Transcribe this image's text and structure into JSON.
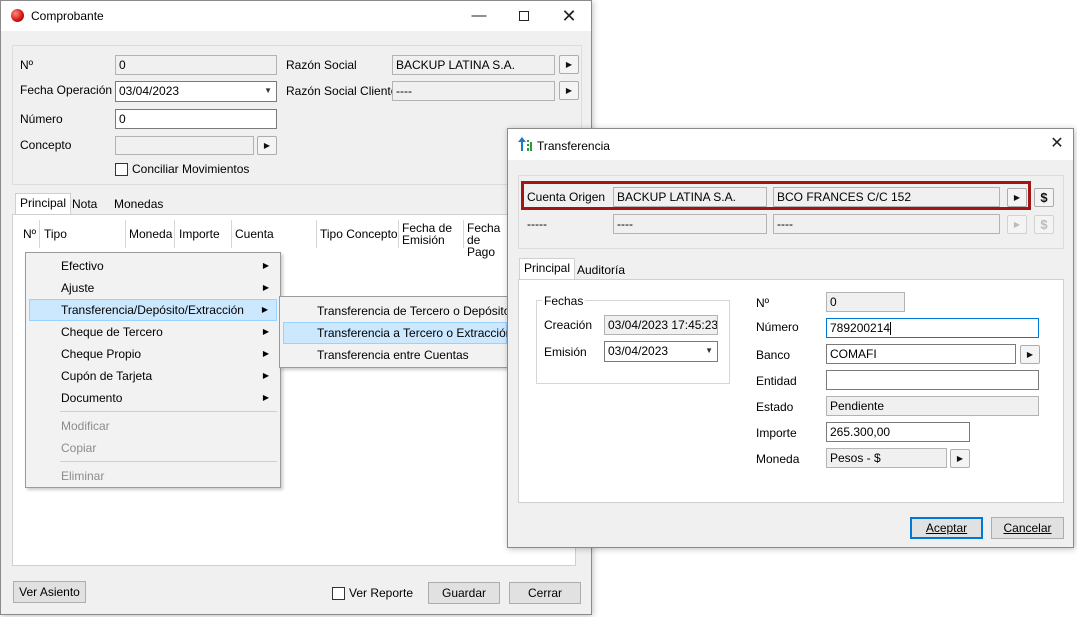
{
  "comprobante": {
    "title": "Comprobante",
    "fields": {
      "numero_label": "Nº",
      "numero_value": "0",
      "fecha_label": "Fecha Operación",
      "fecha_value": "03/04/2023",
      "numero2_label": "Número",
      "numero2_value": "0",
      "concepto_label": "Concepto",
      "concepto_value": "",
      "conciliar_label": "Conciliar Movimientos",
      "razon_label": "Razón Social",
      "razon_value": "BACKUP LATINA S.A.",
      "razon_cliente_label": "Razón Social Cliente",
      "razon_cliente_value": "----"
    },
    "tabs": [
      "Principal",
      "Nota",
      "Monedas"
    ],
    "columns": [
      "Nº",
      "Tipo",
      "Moneda",
      "Importe",
      "Cuenta",
      "Tipo Concepto",
      "Fecha de Emisión",
      "Fecha de Pago"
    ],
    "buttons": {
      "ver_asiento": "Ver Asiento",
      "ver_reporte": "Ver Reporte",
      "guardar": "Guardar",
      "cerrar": "Cerrar"
    }
  },
  "context_menu": {
    "items": [
      {
        "label": "Efectivo",
        "submenu": true,
        "disabled": false
      },
      {
        "label": "Ajuste",
        "submenu": true,
        "disabled": false
      },
      {
        "label": "Transferencia/Depósito/Extracción",
        "submenu": true,
        "disabled": false,
        "highlighted": true
      },
      {
        "label": "Cheque de Tercero",
        "submenu": true,
        "disabled": false
      },
      {
        "label": "Cheque Propio",
        "submenu": true,
        "disabled": false
      },
      {
        "label": "Cupón de Tarjeta",
        "submenu": true,
        "disabled": false
      },
      {
        "label": "Documento",
        "submenu": true,
        "disabled": false
      },
      {
        "label": "Modificar",
        "submenu": false,
        "disabled": true
      },
      {
        "label": "Copiar",
        "submenu": false,
        "disabled": true
      },
      {
        "label": "Eliminar",
        "submenu": false,
        "disabled": true
      }
    ],
    "submenu": [
      {
        "label": "Transferencia de Tercero o Depósito"
      },
      {
        "label": "Transferencia a Tercero o Extracción",
        "highlighted": true
      },
      {
        "label": "Transferencia entre Cuentas"
      }
    ]
  },
  "transferencia": {
    "title": "Transferencia",
    "cuenta_origen_label": "Cuenta Origen",
    "cuenta_origen_razon": "BACKUP LATINA S.A.",
    "cuenta_origen_cuenta": "BCO FRANCES C/C 152",
    "cuenta2_label": "-----",
    "cuenta2_razon": "----",
    "cuenta2_cuenta": "----",
    "dollar_symbol": "$",
    "tabs": [
      "Principal",
      "Auditoría"
    ],
    "fechas": {
      "group_title": "Fechas",
      "creacion_label": "Creación",
      "creacion_value": "03/04/2023 17:45:23",
      "emision_label": "Emisión",
      "emision_value": "03/04/2023"
    },
    "detalle": {
      "nro_label": "Nº",
      "nro_value": "0",
      "numero_label": "Número",
      "numero_value": "789200214",
      "banco_label": "Banco",
      "banco_value": "COMAFI",
      "entidad_label": "Entidad",
      "entidad_value": "",
      "estado_label": "Estado",
      "estado_value": "Pendiente",
      "importe_label": "Importe",
      "importe_value": "265.300,00",
      "moneda_label": "Moneda",
      "moneda_value": "Pesos - $"
    },
    "buttons": {
      "aceptar": "Aceptar",
      "cancelar": "Cancelar"
    },
    "highlight_color": "#a31515"
  }
}
